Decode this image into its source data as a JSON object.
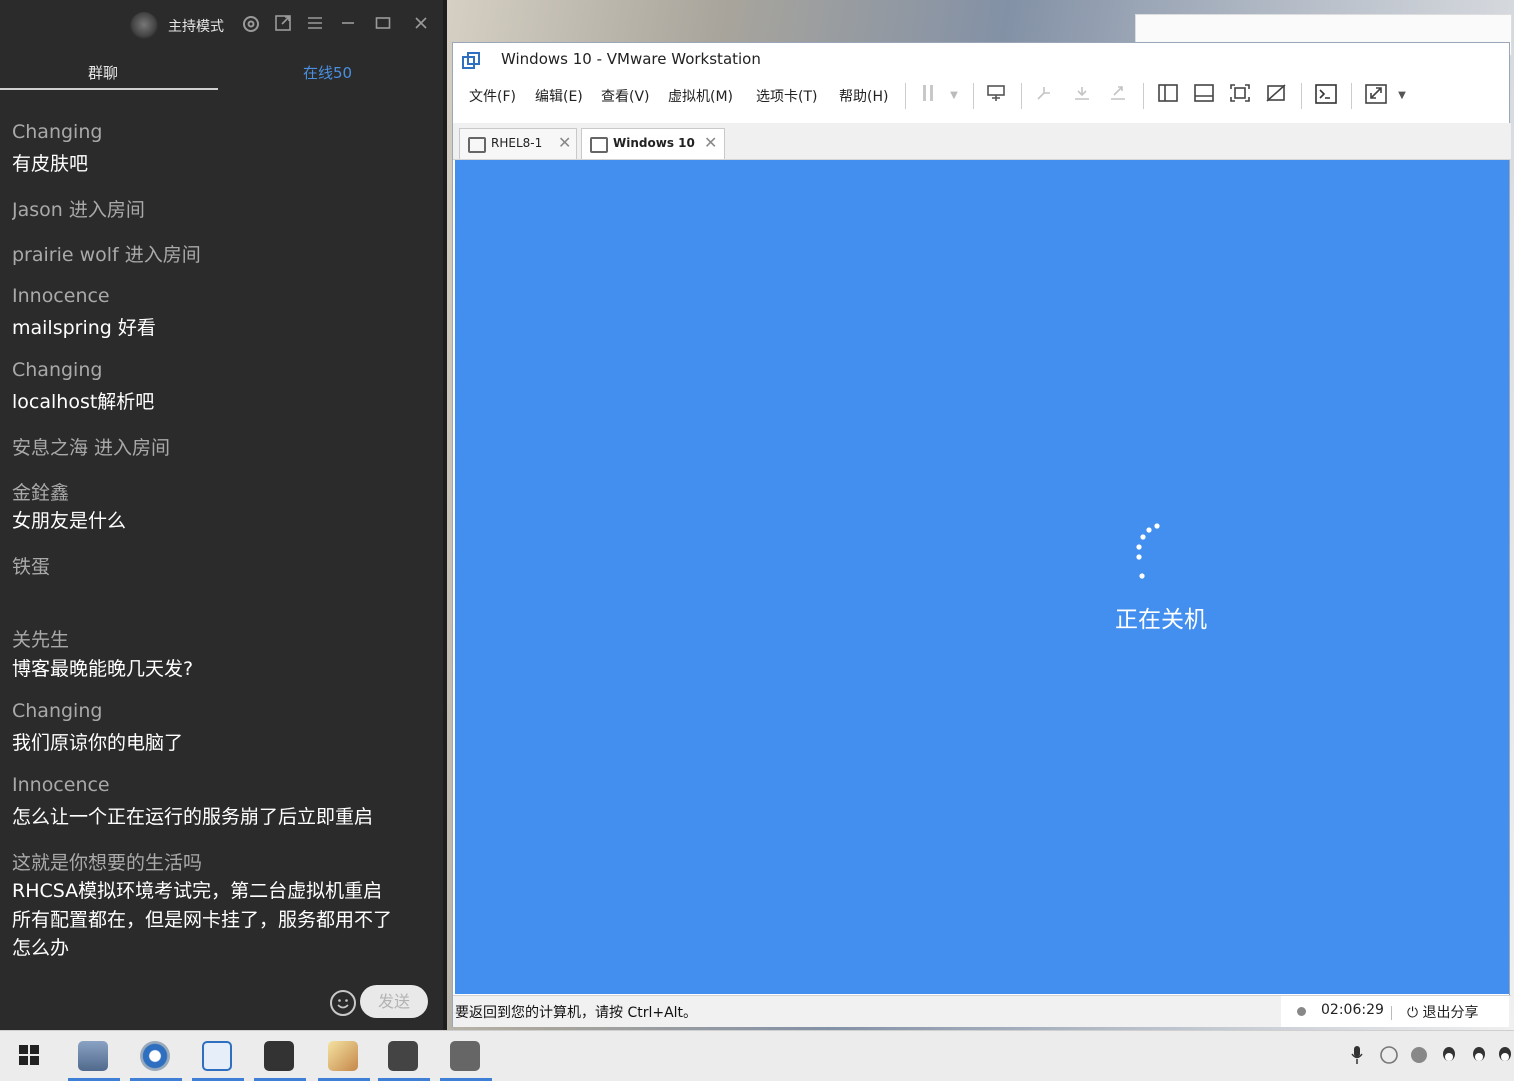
{
  "chat": {
    "host_mode": "主持模式",
    "tabs": {
      "group": "群聊",
      "online": "在线50"
    },
    "messages": [
      {
        "name": "Changing",
        "text": "有皮肤吧"
      },
      {
        "name": "Jason 进入房间",
        "text": ""
      },
      {
        "name": "prairie wolf 进入房间",
        "text": ""
      },
      {
        "name": "Innocence",
        "text": "mailspring 好看"
      },
      {
        "name": "Changing",
        "text": "localhost解析吧"
      },
      {
        "name": "安息之海 进入房间",
        "text": ""
      },
      {
        "name": "金銓鑫",
        "text": "女朋友是什么"
      },
      {
        "name": "铁蛋",
        "text": ""
      },
      {
        "name": "关先生",
        "text": "博客最晚能晚几天发?"
      },
      {
        "name": "Changing",
        "text": "我们原谅你的电脑了"
      },
      {
        "name": "Innocence",
        "text": "怎么让一个正在运行的服务崩了后立即重启"
      },
      {
        "name": "这就是你想要的生活吗",
        "text": "RHCSA模拟环境考试完，第二台虚拟机重启",
        "text2": "所有配置都在，但是网卡挂了，服务都用不了",
        "text3": "怎么办"
      }
    ],
    "send_label": "发送",
    "icons": [
      "settings-icon",
      "popout-icon",
      "menu-icon",
      "minimize-icon",
      "maximize-icon",
      "close-icon",
      "emoji-icon"
    ]
  },
  "vmware": {
    "title": "Windows 10 - VMware Workstation",
    "menus": [
      "文件(F)",
      "编辑(E)",
      "查看(V)",
      "虚拟机(M)",
      "选项卡(T)",
      "帮助(H)"
    ],
    "tabs": [
      {
        "label": "RHEL8-1"
      },
      {
        "label": "Windows 10"
      }
    ],
    "guest_status": "正在关机",
    "status_hint": "要返回到您的计算机，请按 Ctrl+Alt。",
    "share_time": "02:06:29",
    "exit_share": "退出分享"
  },
  "colors": {
    "chat_bg": "#2b2b2b",
    "guest_screen": "#438fef",
    "online_tab": "#4a8fe0"
  }
}
